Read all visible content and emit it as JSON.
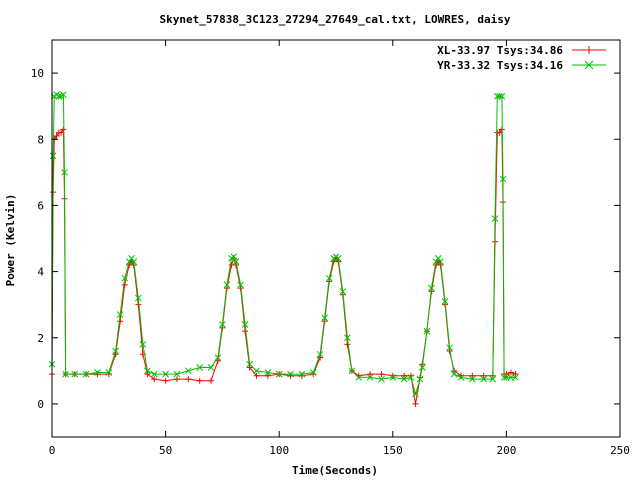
{
  "chart_data": {
    "type": "line",
    "title": "Skynet_57838_3C123_27294_27649_cal.txt, LOWRES, daisy",
    "xlabel": "Time(Seconds)",
    "ylabel": "Power (Kelvin)",
    "xlim": [
      0,
      250
    ],
    "ylim": [
      -1,
      11
    ],
    "xticks": [
      0,
      50,
      100,
      150,
      200,
      250
    ],
    "yticks": [
      0,
      2,
      4,
      6,
      8,
      10
    ],
    "grid": false,
    "legend_position": "top-right",
    "series": [
      {
        "name": "XL-33.97 Tsys:34.86",
        "color": "#ff0000",
        "marker": "plus",
        "x": [
          0,
          0.5,
          1,
          2,
          3,
          4,
          5,
          5.5,
          6,
          10,
          15,
          20,
          25,
          28,
          30,
          32,
          34,
          35,
          36,
          38,
          40,
          42,
          45,
          50,
          55,
          60,
          65,
          70,
          73,
          75,
          77,
          79,
          80,
          81,
          83,
          85,
          87,
          90,
          95,
          100,
          105,
          110,
          115,
          118,
          120,
          122,
          124,
          125,
          126,
          128,
          130,
          132,
          135,
          140,
          145,
          150,
          155,
          158,
          160,
          162,
          163,
          165,
          167,
          169,
          170,
          171,
          173,
          175,
          177,
          180,
          185,
          190,
          194,
          195,
          196,
          197,
          198,
          198.5,
          199,
          200,
          202,
          204
        ],
        "y": [
          0.9,
          6.4,
          8.0,
          8.1,
          8.2,
          8.2,
          8.3,
          6.2,
          0.9,
          0.9,
          0.9,
          0.9,
          0.9,
          1.5,
          2.5,
          3.6,
          4.2,
          4.3,
          4.2,
          3.0,
          1.5,
          0.9,
          0.75,
          0.7,
          0.75,
          0.75,
          0.7,
          0.7,
          1.3,
          2.3,
          3.5,
          4.2,
          4.4,
          4.2,
          3.5,
          2.2,
          1.1,
          0.85,
          0.85,
          0.9,
          0.85,
          0.85,
          0.9,
          1.4,
          2.5,
          3.7,
          4.3,
          4.4,
          4.3,
          3.3,
          1.8,
          1.0,
          0.85,
          0.9,
          0.9,
          0.85,
          0.85,
          0.85,
          0.0,
          0.8,
          1.2,
          2.2,
          3.4,
          4.2,
          4.3,
          4.2,
          3.0,
          1.6,
          1.0,
          0.85,
          0.85,
          0.85,
          0.85,
          4.9,
          8.2,
          8.2,
          8.3,
          6.1,
          0.9,
          0.9,
          0.95,
          0.9
        ]
      },
      {
        "name": "YR-33.32 Tsys:34.16",
        "color": "#00c000",
        "marker": "cross",
        "x": [
          0,
          0.5,
          1,
          2,
          3,
          4,
          5,
          5.5,
          6,
          10,
          15,
          20,
          25,
          28,
          30,
          32,
          34,
          35,
          36,
          38,
          40,
          42,
          45,
          50,
          55,
          60,
          65,
          70,
          73,
          75,
          77,
          79,
          80,
          81,
          83,
          85,
          87,
          90,
          95,
          100,
          105,
          110,
          115,
          118,
          120,
          122,
          124,
          125,
          126,
          128,
          130,
          132,
          135,
          140,
          145,
          150,
          155,
          158,
          160,
          162,
          163,
          165,
          167,
          169,
          170,
          171,
          173,
          175,
          177,
          180,
          185,
          190,
          194,
          195,
          196,
          197,
          198,
          198.5,
          199,
          200,
          202,
          204
        ],
        "y": [
          1.2,
          7.5,
          9.3,
          9.35,
          9.3,
          9.3,
          9.35,
          7.0,
          0.9,
          0.9,
          0.9,
          0.95,
          0.95,
          1.6,
          2.7,
          3.8,
          4.3,
          4.4,
          4.3,
          3.2,
          1.8,
          1.0,
          0.9,
          0.9,
          0.9,
          1.0,
          1.1,
          1.1,
          1.4,
          2.4,
          3.6,
          4.4,
          4.45,
          4.3,
          3.6,
          2.4,
          1.2,
          1.0,
          0.95,
          0.9,
          0.9,
          0.9,
          0.95,
          1.5,
          2.6,
          3.8,
          4.4,
          4.45,
          4.4,
          3.4,
          2.0,
          1.0,
          0.8,
          0.8,
          0.75,
          0.8,
          0.75,
          0.8,
          0.3,
          0.75,
          1.1,
          2.2,
          3.5,
          4.3,
          4.4,
          4.3,
          3.1,
          1.7,
          0.9,
          0.8,
          0.75,
          0.75,
          0.75,
          5.6,
          9.3,
          9.3,
          9.3,
          6.8,
          0.8,
          0.8,
          0.8,
          0.8
        ]
      }
    ]
  }
}
